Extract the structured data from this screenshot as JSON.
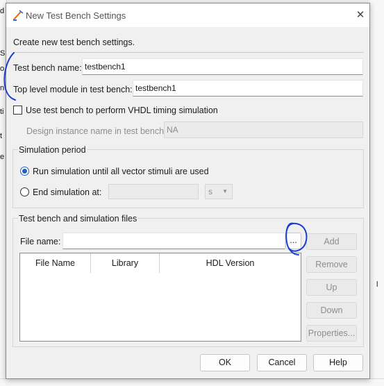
{
  "background": {
    "left_glyphs": [
      "d",
      "S",
      "o",
      "n",
      "ti",
      "t",
      "e"
    ],
    "right_glyph": "l"
  },
  "dialog": {
    "title": "New Test Bench Settings",
    "close_icon": "close-icon",
    "header_text": "Create new test bench settings."
  },
  "form": {
    "testbench_name_label": "Test bench name:",
    "testbench_name_value": "testbench1",
    "top_module_label": "Top level module in test bench:",
    "top_module_value": "testbench1",
    "vhdl_timing_label": "Use test bench to perform VHDL timing simulation",
    "vhdl_timing_checked": false,
    "design_instance_label": "Design instance name in test bench:",
    "design_instance_value": "NA"
  },
  "simulation_period": {
    "title": "Simulation period",
    "run_until_label": "Run simulation until all vector stimuli are used",
    "end_at_label": "End simulation at:",
    "end_at_value": "",
    "unit_value": "s",
    "selected": "run_until"
  },
  "files": {
    "title": "Test bench and simulation files",
    "file_name_label": "File name:",
    "file_name_value": "",
    "browse_label": "...",
    "columns": [
      "File Name",
      "Library",
      "HDL Version"
    ],
    "rows": [],
    "buttons": {
      "add": "Add",
      "remove": "Remove",
      "up": "Up",
      "down": "Down",
      "properties": "Properties..."
    }
  },
  "footer": {
    "ok": "OK",
    "cancel": "Cancel",
    "help": "Help"
  },
  "colors": {
    "accent": "#1e62c5",
    "annotation": "#1a3fd0"
  }
}
